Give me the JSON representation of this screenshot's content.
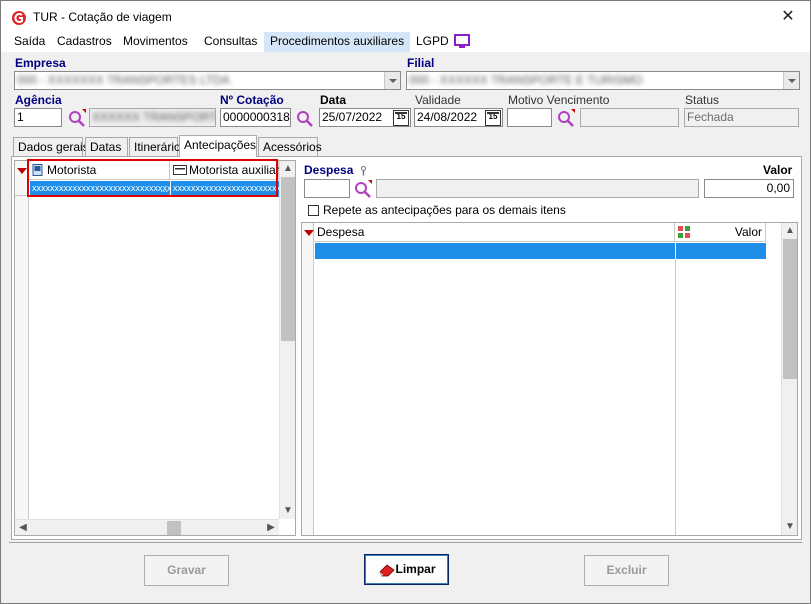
{
  "window": {
    "title": "TUR - Cotação de viagem"
  },
  "menu": [
    {
      "label": "Saída",
      "highlighted": false
    },
    {
      "label": "Cadastros",
      "highlighted": false
    },
    {
      "label": "Movimentos",
      "highlighted": false
    },
    {
      "label": "Consultas",
      "highlighted": false
    },
    {
      "label": "Procedimentos auxiliares",
      "highlighted": true
    },
    {
      "label": "LGPD",
      "highlighted": false
    }
  ],
  "form": {
    "empresa_label": "Empresa",
    "empresa_value": "000 - XXXXXXX TRANSPORTES LTDA",
    "filial_label": "Filial",
    "filial_value": "000 - XXXXXX TRANSPORTE E TURISMO",
    "agencia_label": "Agência",
    "agencia_value": "1",
    "agencia_name": "XXXXXX TRANSPORTE",
    "cotacao_label": "Nº Cotação",
    "cotacao_value": "0000000318",
    "data_label": "Data",
    "data_value": "25/07/2022",
    "validade_label": "Validade",
    "validade_value": "24/08/2022",
    "motivo_label": "Motivo Vencimento",
    "motivo_value": "",
    "status_label": "Status",
    "status_value": "Fechada",
    "calendar_glyph": "15"
  },
  "tabs": [
    {
      "label": "Dados gerais",
      "active": false
    },
    {
      "label": "Datas",
      "active": false
    },
    {
      "label": "Itinerário",
      "active": false
    },
    {
      "label": "Antecipações",
      "active": true
    },
    {
      "label": "Acessórios",
      "active": false
    }
  ],
  "left_grid": {
    "columns": [
      "Motorista",
      "Motorista auxiliar"
    ],
    "rows": [
      [
        "xxxxxxxxxxxxxxxxxxxxxxxxxxxxxxx",
        "xxxxxxxxxxxxxxxxxxxxxxxxxxx"
      ]
    ],
    "cell_ellipsis": "..."
  },
  "despesa": {
    "label": "Despesa",
    "value_label": "Valor",
    "value": "0,00",
    "repeat_label": "Repete as antecipações para os demais itens",
    "repeat_checked": false
  },
  "right_grid": {
    "columns": [
      "Despesa",
      "Valor"
    ]
  },
  "buttons": {
    "save": "Gravar",
    "clear": "Limpar",
    "delete": "Excluir"
  },
  "colors": {
    "selection": "#1e8ee8",
    "label_blue": "#000080",
    "highlight_border": "#e00000",
    "sort_red": "#c00000"
  }
}
